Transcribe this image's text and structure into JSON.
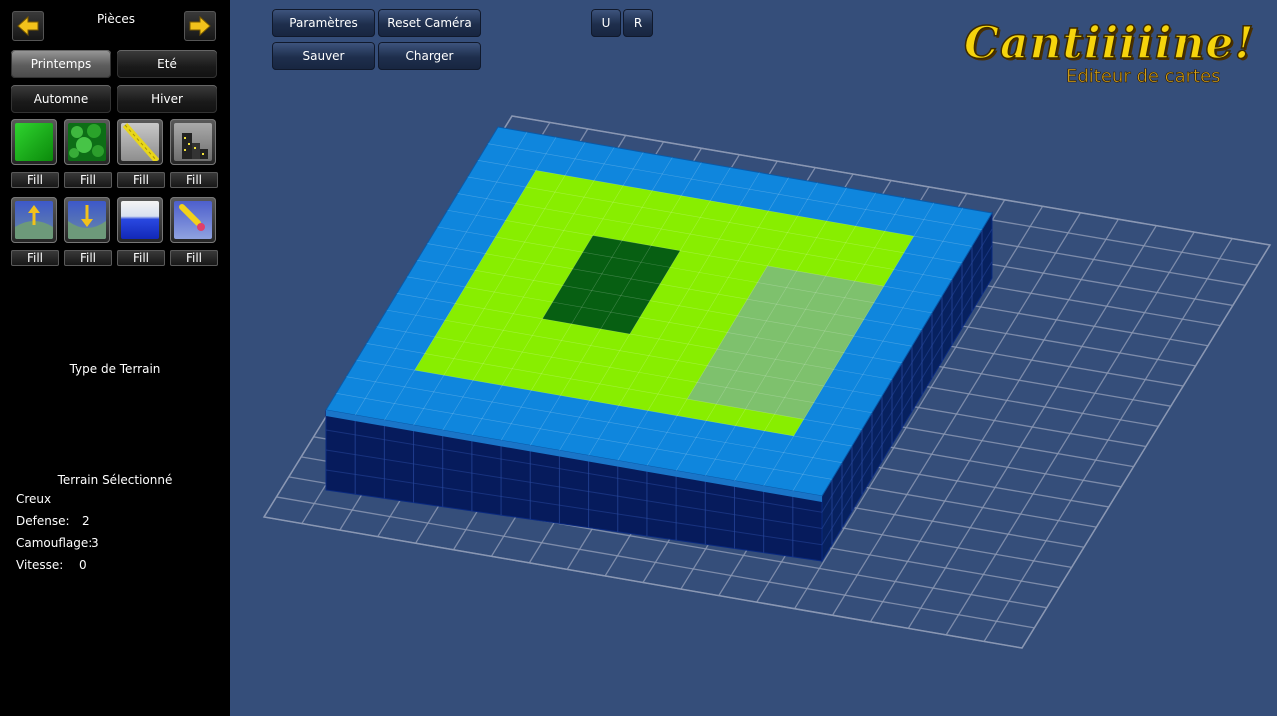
{
  "sidebar": {
    "title": "Pièces",
    "seasons": [
      "Printemps",
      "Eté",
      "Automne",
      "Hiver"
    ],
    "active_season": "Printemps",
    "tile_icons": [
      "grass-tile-icon",
      "forest-tile-icon",
      "road-tile-icon",
      "city-tile-icon",
      "raise-terrain-icon",
      "lower-terrain-icon",
      "water-tile-icon",
      "paint-brush-icon"
    ],
    "fill_label": "Fill",
    "terrain_type_label": "Type de Terrain",
    "selected_terrain_label": "Terrain Sélectionné",
    "selected": {
      "name": "Creux",
      "defense_label": "Defense:",
      "defense": "2",
      "camouflage_label": "Camouflage:",
      "camouflage": "3",
      "speed_label": "Vitesse:",
      "speed": "0"
    }
  },
  "toolbar": {
    "parametres": "Paramètres",
    "reset_camera": "Reset Caméra",
    "sauver": "Sauver",
    "charger": "Charger",
    "undo": "U",
    "redo": "R"
  },
  "logo": {
    "title": "Cantiiiiine!",
    "subtitle": "Editeur de cartes"
  },
  "colors": {
    "background": "#354e7a",
    "water_top": "#0f86dd",
    "water_side": "#061b5c",
    "grass": "#88ee00",
    "forest": "#075f12",
    "selection": "#7dbd76",
    "accent_arrow": "#f2c21b"
  }
}
